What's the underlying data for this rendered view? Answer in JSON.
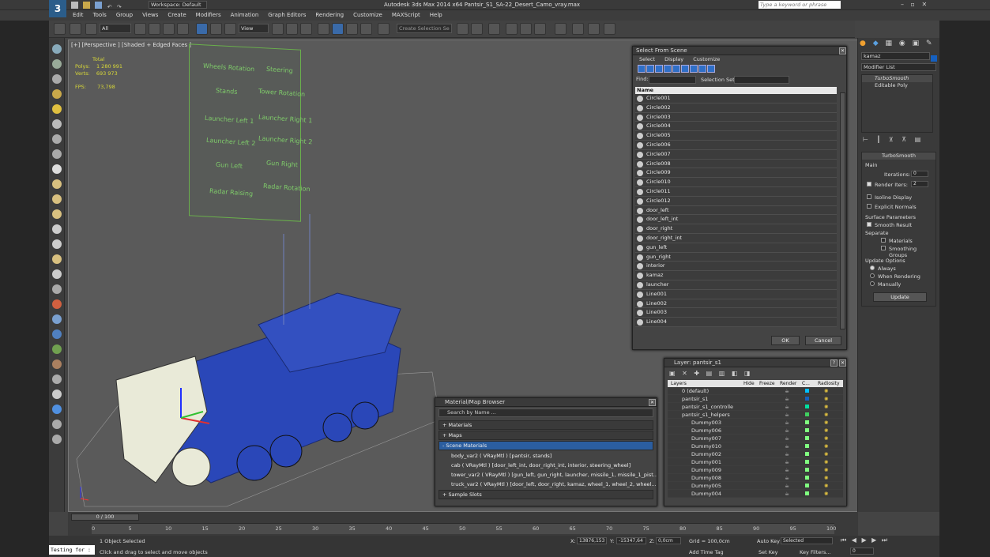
{
  "app": {
    "title": "Autodesk 3ds Max  2014 x64     Pantsir_S1_SA-22_Desert_Camo_vray.max",
    "workspace": "Workspace: Default",
    "search_placeholder": "Type a keyword or phrase"
  },
  "menu": [
    "Edit",
    "Tools",
    "Group",
    "Views",
    "Create",
    "Modifiers",
    "Animation",
    "Graph Editors",
    "Rendering",
    "Customize",
    "MAXScript",
    "Help"
  ],
  "toolbar": {
    "filter": "All",
    "view": "View",
    "selection_set": "Create Selection Se"
  },
  "viewport": {
    "label": "[+] [Perspective ] [Shaded + Edged Faces ]",
    "stats_total": "Total",
    "polys_label": "Polys:",
    "polys": "1 280 991",
    "verts_label": "Verts:",
    "verts": "693 973",
    "fps_label": "FPS:",
    "fps": "73,798",
    "panel_labels": [
      "Wheels Rotation",
      "Steering",
      "Stands",
      "Tower Rotation",
      "Launcher Left 1",
      "Launcher Right 1",
      "Launcher Left 2",
      "Launcher Right 2",
      "Gun Left",
      "Gun Right",
      "Radar Raising",
      "Radar Rotation"
    ]
  },
  "select_dialog": {
    "title": "Select From Scene",
    "tabs": [
      "Select",
      "Display",
      "Customize"
    ],
    "find_label": "Find:",
    "selset_label": "Selection Set:",
    "col_name": "Name",
    "items": [
      "Circle001",
      "Circle002",
      "Circle003",
      "Circle004",
      "Circle005",
      "Circle006",
      "Circle007",
      "Circle008",
      "Circle009",
      "Circle010",
      "Circle011",
      "Circle012",
      "door_left",
      "door_left_int",
      "door_right",
      "door_right_int",
      "gun_left",
      "gun_right",
      "interior",
      "kamaz",
      "launcher",
      "Line001",
      "Line002",
      "Line003",
      "Line004"
    ],
    "ok": "OK",
    "cancel": "Cancel"
  },
  "layer_dialog": {
    "title": "Layer: pantsir_s1",
    "cols": [
      "Layers",
      "Hide",
      "Freeze",
      "Render",
      "C...",
      "Radiosity"
    ],
    "rows": [
      "0 (default)",
      "pantsir_s1",
      "pantsir_s1_controlle",
      "pantsir_s1_helpers",
      "Dummy003",
      "Dummy006",
      "Dummy007",
      "Dummy010",
      "Dummy002",
      "Dummy001",
      "Dummy009",
      "Dummy008",
      "Dummy005",
      "Dummy004"
    ]
  },
  "material_browser": {
    "title": "Material/Map Browser",
    "search": "Search by Name ...",
    "groups": [
      "+ Materials",
      "+ Maps",
      "- Scene Materials",
      "+ Sample Slots"
    ],
    "materials": [
      "body_var2  ( VRayMtl ) [pantsir, stands]",
      "cab  ( VRayMtl ) [door_left_int, door_right_int, interior, steering_wheel]",
      "tower_var2  ( VRayMtl ) [gun_left, gun_right, launcher, missile_1, missile_1_pist...",
      "truck_var2  ( VRayMtl ) [door_left, door_right, kamaz, wheel_1, wheel_2, wheel..."
    ]
  },
  "command_panel": {
    "object_name": "kamaz",
    "modifier_list": "Modifier List",
    "stack": [
      "TurboSmooth",
      "Editable Poly"
    ],
    "rollout": "TurboSmooth",
    "main": "Main",
    "iterations_label": "Iterations:",
    "iterations": "0",
    "render_iters_label": "Render Iters:",
    "render_iters": "2",
    "isoline": "Isoline Display",
    "explicit": "Explicit Normals",
    "surface": "Surface Parameters",
    "smooth": "Smooth Result",
    "separate": "Separate",
    "materials": "Materials",
    "smoothing": "Smoothing Groups",
    "update_opts": "Update Options",
    "always": "Always",
    "when_rendering": "When Rendering",
    "manually": "Manually",
    "update": "Update"
  },
  "timeline": {
    "frame": "0 / 100",
    "ticks": [
      "0",
      "5",
      "10",
      "15",
      "20",
      "25",
      "30",
      "35",
      "40",
      "45",
      "50",
      "55",
      "60",
      "65",
      "70",
      "75",
      "80",
      "85",
      "90",
      "95",
      "100"
    ]
  },
  "status": {
    "script": "Testing for :",
    "selected": "1 Object Selected",
    "prompt": "Click and drag to select and move objects",
    "x_label": "X:",
    "x": "13876,153",
    "y_label": "Y:",
    "y": "-15347,64",
    "z_label": "Z:",
    "z": "0,0cm",
    "grid": "Grid = 100,0cm",
    "autokey": "Auto Key",
    "autokey_val": "Selected",
    "setkey": "Set Key",
    "keyfilters": "Key Filters...",
    "add_time_tag": "Add Time Tag",
    "frame_field": "0"
  }
}
